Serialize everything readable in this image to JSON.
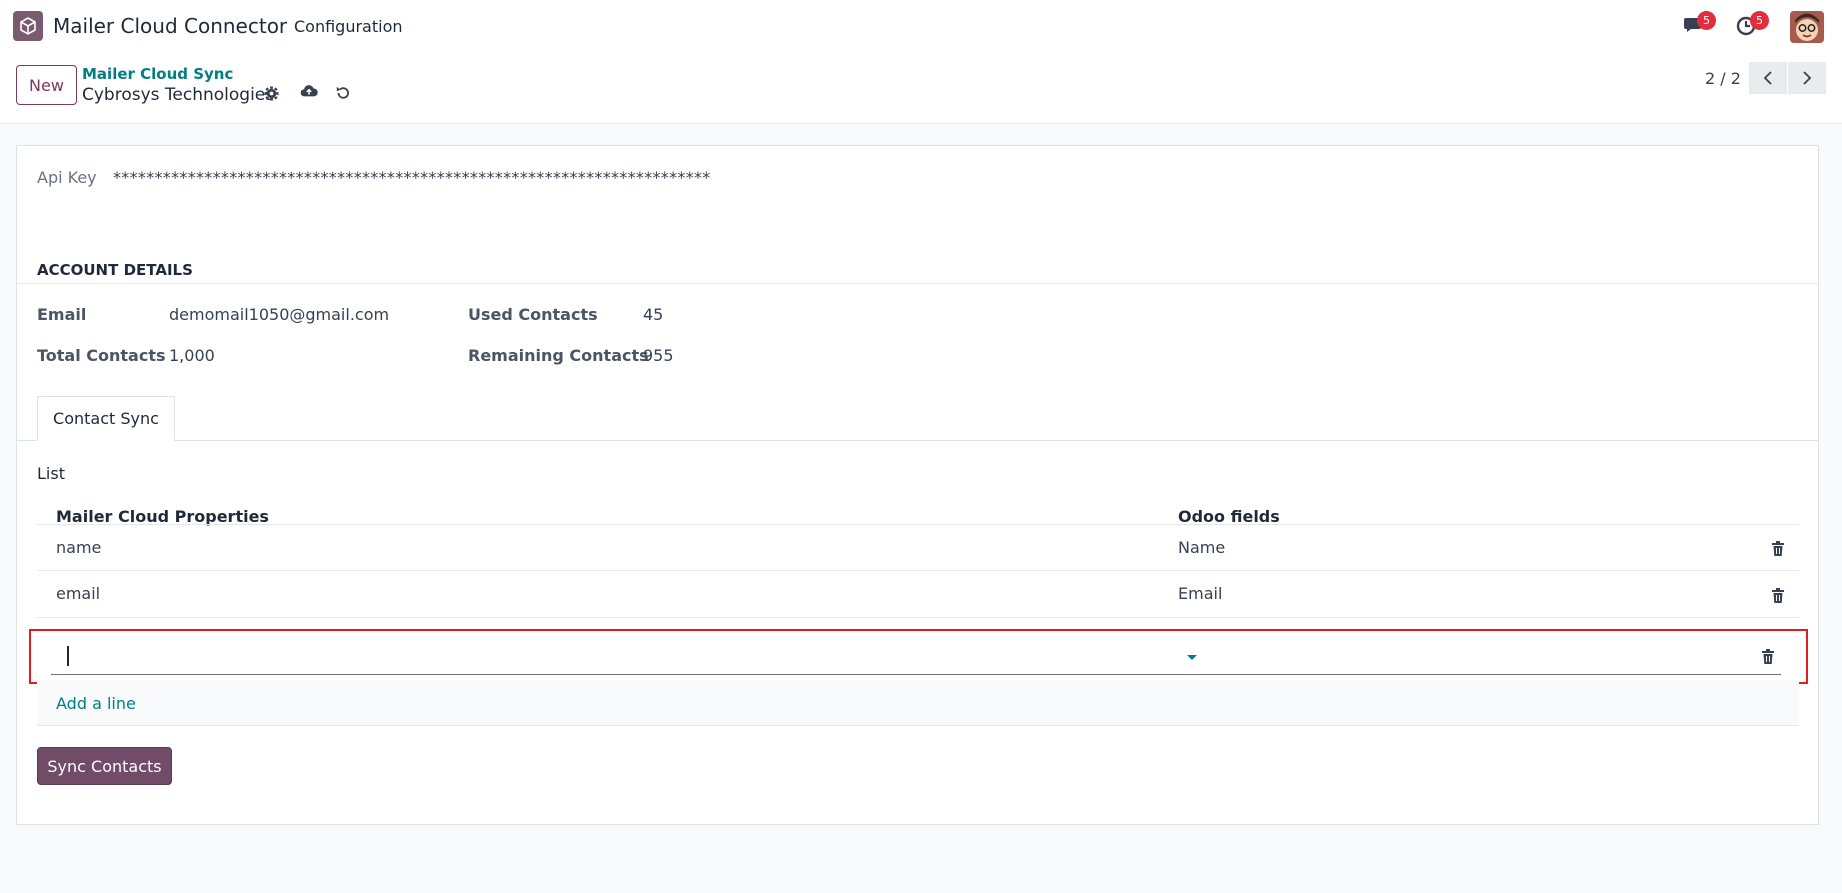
{
  "topbar": {
    "app_title": "Mailer Cloud Connector",
    "menu_configuration": "Configuration",
    "messages_badge": "5",
    "activities_badge": "5"
  },
  "control": {
    "new_label": "New",
    "breadcrumb_parent": "Mailer Cloud Sync",
    "breadcrumb_current": "Cybrosys Technologies",
    "pager": "2 / 2"
  },
  "form": {
    "api_key_label": "Api Key",
    "api_key_value": "************************************************************************",
    "section_title": "ACCOUNT DETAILS",
    "email_label": "Email",
    "email_value": "demomail1050@gmail.com",
    "total_contacts_label": "Total Contacts",
    "total_contacts_value": "1,000",
    "used_contacts_label": "Used Contacts",
    "used_contacts_value": "45",
    "remaining_contacts_label": "Remaining Contacts",
    "remaining_contacts_value": "955"
  },
  "tabs": [
    {
      "label": "Contact Sync"
    }
  ],
  "list": {
    "label": "List",
    "columns": [
      "Mailer Cloud Properties",
      "Odoo fields"
    ],
    "rows": [
      {
        "property": "name",
        "field": "Name"
      },
      {
        "property": "email",
        "field": "Email"
      }
    ],
    "edit_row_value": "",
    "add_line": "Add a line"
  },
  "actions": {
    "sync_contacts": "Sync Contacts"
  },
  "colors": {
    "brand": "#714b67",
    "link": "#017e84",
    "badge": "#e02f3b",
    "highlight": "#e11d1d"
  }
}
